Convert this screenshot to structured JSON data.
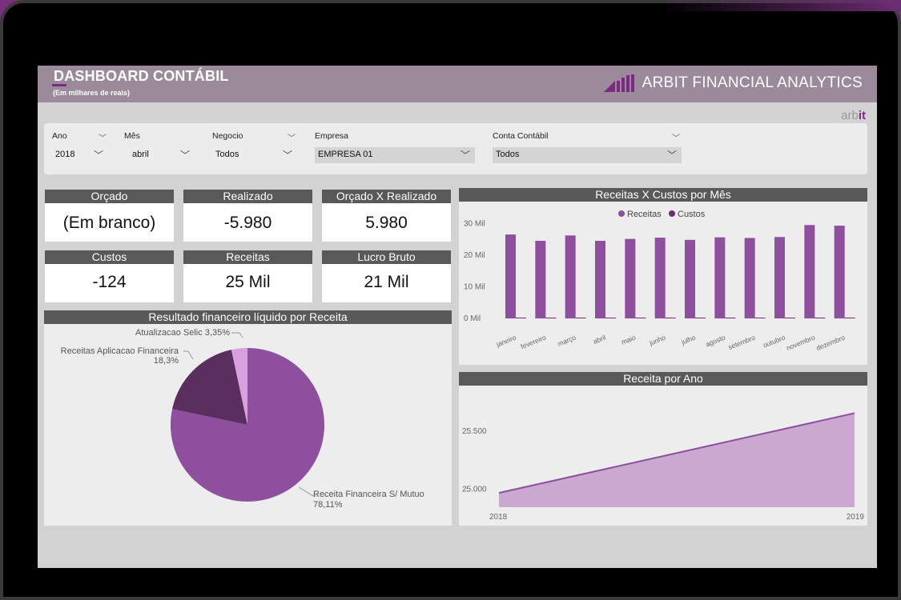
{
  "header": {
    "title": "DASHBOARD CONTÁBIL",
    "subtitle": "(Em milhares de reais)",
    "brand": "ARBIT FINANCIAL ANALYTICS",
    "small_logo_a": "arb",
    "small_logo_b": "it"
  },
  "filters": [
    {
      "label": "Ano",
      "value": "2018"
    },
    {
      "label": "Mês",
      "value": "abril"
    },
    {
      "label": "Negocio",
      "value": "Todos"
    },
    {
      "label": "Empresa",
      "value": "EMPRESA 01"
    },
    {
      "label": "Conta Contábil",
      "value": "Todos"
    }
  ],
  "cards": [
    {
      "title": "Orçado",
      "value": "(Em branco)"
    },
    {
      "title": "Realizado",
      "value": "-5.980"
    },
    {
      "title": "Orçado X Realizado",
      "value": "5.980"
    },
    {
      "title": "Custos",
      "value": "-124"
    },
    {
      "title": "Receitas",
      "value": "25 Mil"
    },
    {
      "title": "Lucro Bruto",
      "value": "21 Mil"
    }
  ],
  "colors": {
    "receitas": "#8e4f9e",
    "custos": "#6a2f6f",
    "pie_main": "#8e4f9e",
    "pie_dark": "#5a2e5e",
    "pie_light": "#d9a0e0",
    "area_fill": "#c9a9cf",
    "area_line": "#8e4f9e"
  },
  "pie": {
    "title": "Resultado financeiro líquido por Receita",
    "slices": [
      {
        "label": "Receita Financeira S/ Mutuo",
        "pct_label": "78,11%",
        "value": 78.11
      },
      {
        "label": "Receitas Aplicacao Financeira",
        "pct_label": "18,3%",
        "value": 18.3
      },
      {
        "label": "Atualizacao Selic",
        "pct_label": "3,35%",
        "value": 3.35
      }
    ],
    "label_selic": "Atualizacao Selic 3,35%"
  },
  "chart_data": [
    {
      "type": "bar",
      "title": "Receitas X Custos por Mês",
      "legend": [
        "Receitas",
        "Custos"
      ],
      "categories": [
        "janeiro",
        "fevereiro",
        "março",
        "abril",
        "maio",
        "junho",
        "julho",
        "agosto",
        "setembro",
        "outubro",
        "novembro",
        "dezembro"
      ],
      "series": [
        {
          "name": "Receitas",
          "values": [
            26.6,
            24.6,
            26.3,
            24.6,
            25.2,
            25.6,
            24.9,
            25.7,
            25.5,
            25.8,
            29.6,
            29.4
          ]
        },
        {
          "name": "Custos",
          "values": [
            0.1,
            0.1,
            0.1,
            0.1,
            0.1,
            0.1,
            0.1,
            0.1,
            0.1,
            0.1,
            0.1,
            0.1
          ]
        }
      ],
      "yticks": [
        "0 Mil",
        "10 Mil",
        "20 Mil",
        "30 Mil"
      ],
      "ylim": [
        0,
        35
      ]
    },
    {
      "type": "area",
      "title": "Receita por Ano",
      "x": [
        "2018",
        "2019"
      ],
      "values": [
        24.96,
        25.65
      ],
      "yticks": [
        "25.000",
        "25.500"
      ],
      "ylim": [
        24.85,
        25.75
      ]
    }
  ]
}
